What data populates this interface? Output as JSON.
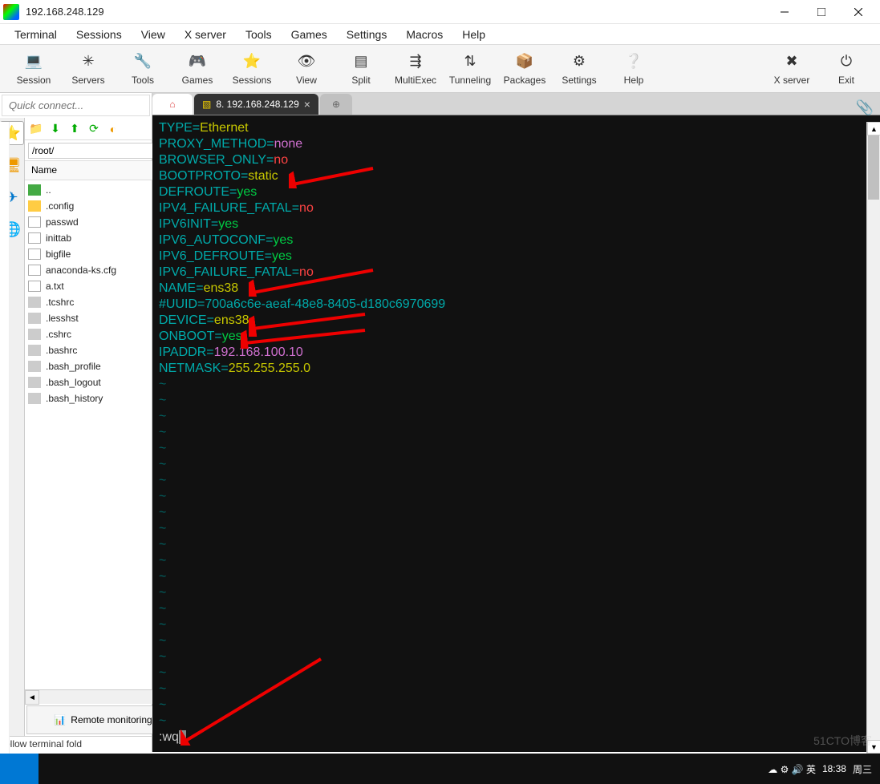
{
  "window": {
    "title": "192.168.248.129"
  },
  "menu": [
    "Terminal",
    "Sessions",
    "View",
    "X server",
    "Tools",
    "Games",
    "Settings",
    "Macros",
    "Help"
  ],
  "toolbar": [
    {
      "label": "Session",
      "icon": "💻"
    },
    {
      "label": "Servers",
      "icon": "✳"
    },
    {
      "label": "Tools",
      "icon": "🔧"
    },
    {
      "label": "Games",
      "icon": "🎮"
    },
    {
      "label": "Sessions",
      "icon": "⭐"
    },
    {
      "label": "View",
      "icon": "👁"
    },
    {
      "label": "Split",
      "icon": "▤"
    },
    {
      "label": "MultiExec",
      "icon": "⇶"
    },
    {
      "label": "Tunneling",
      "icon": "⇅"
    },
    {
      "label": "Packages",
      "icon": "📦"
    },
    {
      "label": "Settings",
      "icon": "⚙"
    },
    {
      "label": "Help",
      "icon": "❔"
    }
  ],
  "toolbar_right": [
    {
      "label": "X server",
      "icon": "✖"
    },
    {
      "label": "Exit",
      "icon": "⏻"
    }
  ],
  "sidebar": {
    "quick_placeholder": "Quick connect...",
    "path": "/root/",
    "name_header": "Name",
    "files": [
      {
        "name": "..",
        "type": "folder-green"
      },
      {
        "name": ".config",
        "type": "folder"
      },
      {
        "name": "passwd",
        "type": "file"
      },
      {
        "name": "inittab",
        "type": "file"
      },
      {
        "name": "bigfile",
        "type": "file"
      },
      {
        "name": "anaconda-ks.cfg",
        "type": "file"
      },
      {
        "name": "a.txt",
        "type": "file"
      },
      {
        "name": ".tcshrc",
        "type": "file-gray"
      },
      {
        "name": ".lesshst",
        "type": "file-gray"
      },
      {
        "name": ".cshrc",
        "type": "file-gray"
      },
      {
        "name": ".bashrc",
        "type": "file-gray"
      },
      {
        "name": ".bash_profile",
        "type": "file-gray"
      },
      {
        "name": ".bash_logout",
        "type": "file-gray"
      },
      {
        "name": ".bash_history",
        "type": "file-gray"
      }
    ],
    "remote_mon": "Remote monitoring",
    "status": "ollow terminal fold"
  },
  "tabs": {
    "active": "8. 192.168.248.129"
  },
  "terminal": {
    "lines": [
      [
        [
          "k",
          "TYPE"
        ],
        [
          "k",
          "="
        ],
        [
          "v-yel",
          "Ethernet"
        ]
      ],
      [
        [
          "k",
          "PROXY_METHOD"
        ],
        [
          "k",
          "="
        ],
        [
          "v-mag",
          "none"
        ]
      ],
      [
        [
          "k",
          "BROWSER_ONLY"
        ],
        [
          "k",
          "="
        ],
        [
          "v-red",
          "no"
        ]
      ],
      [
        [
          "k",
          "BOOTPROTO"
        ],
        [
          "k",
          "="
        ],
        [
          "v-yel",
          "static"
        ]
      ],
      [
        [
          "k",
          "DEFROUTE"
        ],
        [
          "k",
          "="
        ],
        [
          "v-grn",
          "yes"
        ]
      ],
      [
        [
          "k",
          "IPV4_FAILURE_FATAL"
        ],
        [
          "k",
          "="
        ],
        [
          "v-red",
          "no"
        ]
      ],
      [
        [
          "k",
          "IPV6INIT"
        ],
        [
          "k",
          "="
        ],
        [
          "v-grn",
          "yes"
        ]
      ],
      [
        [
          "k",
          "IPV6_AUTOCONF"
        ],
        [
          "k",
          "="
        ],
        [
          "v-grn",
          "yes"
        ]
      ],
      [
        [
          "k",
          "IPV6_DEFROUTE"
        ],
        [
          "k",
          "="
        ],
        [
          "v-grn",
          "yes"
        ]
      ],
      [
        [
          "k",
          "IPV6_FAILURE_FATAL"
        ],
        [
          "k",
          "="
        ],
        [
          "v-red",
          "no"
        ]
      ],
      [
        [
          "k",
          "NAME"
        ],
        [
          "k",
          "="
        ],
        [
          "v-yel",
          "ens38"
        ]
      ],
      [
        [
          "k",
          "#UUID=700a6c6e-aeaf-48e8-8405-d180c6970699"
        ]
      ],
      [
        [
          "k",
          "DEVICE"
        ],
        [
          "k",
          "="
        ],
        [
          "v-yel",
          "ens38"
        ]
      ],
      [
        [
          "k",
          "ONBOOT"
        ],
        [
          "k",
          "="
        ],
        [
          "v-grn",
          "yes"
        ]
      ],
      [
        [
          "k",
          "IPADDR"
        ],
        [
          "k",
          "="
        ],
        [
          "v-mag",
          "192.168.100.10"
        ]
      ],
      [
        [
          "k",
          "NETMASK"
        ],
        [
          "k",
          "="
        ],
        [
          "v-yel",
          "255.255.255.0"
        ]
      ]
    ],
    "cmd": ":wq"
  },
  "taskbar": {
    "time": "18:38",
    "day": "周三"
  }
}
